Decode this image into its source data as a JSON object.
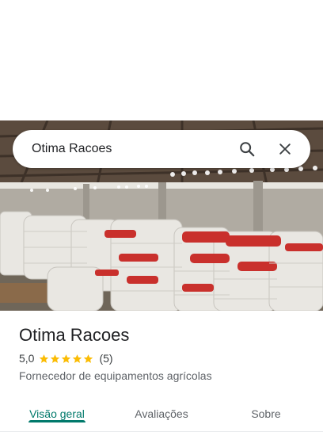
{
  "search": {
    "query": "Otima Racoes",
    "search_icon": "search-icon",
    "close_icon": "close-icon"
  },
  "place": {
    "title": "Otima Racoes",
    "rating": "5,0",
    "stars": 5,
    "review_count": "(5)",
    "category": "Fornecedor de equipamentos agrícolas"
  },
  "tabs": [
    {
      "label": "Visão geral",
      "active": true
    },
    {
      "label": "Avaliações",
      "active": false
    },
    {
      "label": "Sobre",
      "active": false
    }
  ],
  "colors": {
    "accent": "#00796b",
    "star": "#fbbc04"
  }
}
